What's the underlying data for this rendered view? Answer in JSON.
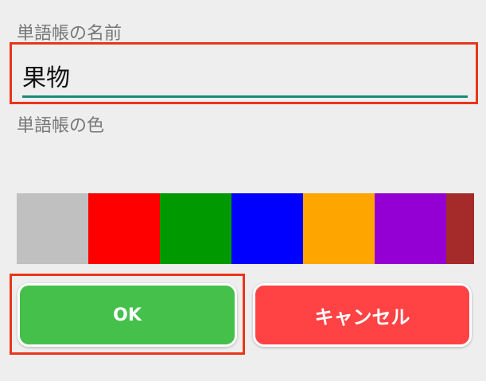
{
  "form": {
    "name_label": "単語帳の名前",
    "name_value": "果物",
    "color_label": "単語帳の色"
  },
  "swatches": [
    {
      "color": "#c0c0c0"
    },
    {
      "color": "#ff0000"
    },
    {
      "color": "#009a00"
    },
    {
      "color": "#0000ff"
    },
    {
      "color": "#ffa500"
    },
    {
      "color": "#9400d3"
    },
    {
      "color": "#a52a2a"
    }
  ],
  "buttons": {
    "ok_label": "OK",
    "cancel_label": "キャンセル"
  },
  "colors": {
    "highlight": "#e8361a",
    "ok": "#44c04b",
    "cancel": "#ff4345",
    "input_underline": "#1b8a7a"
  }
}
